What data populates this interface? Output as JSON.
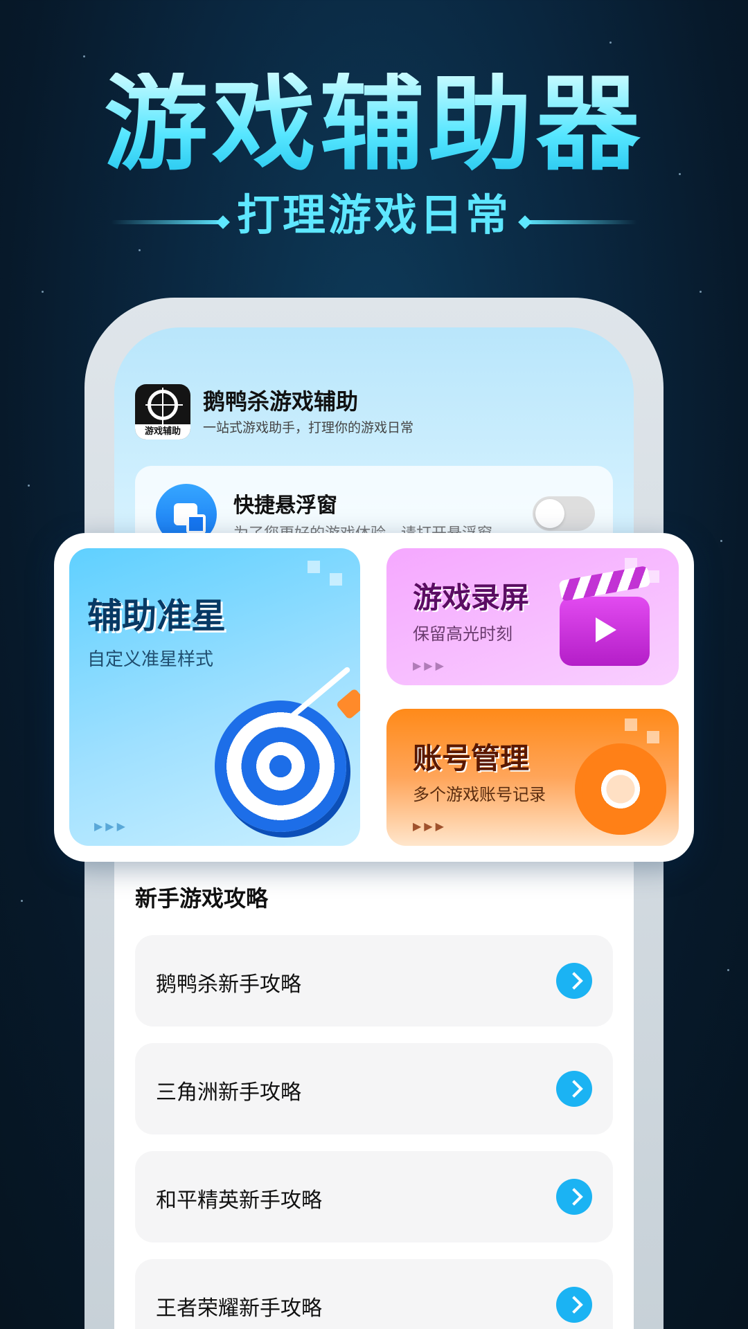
{
  "hero": {
    "title": "游戏辅助器",
    "subtitle": "打理游戏日常"
  },
  "app": {
    "icon_label": "游戏辅助",
    "name": "鹅鸭杀游戏辅助",
    "description": "一站式游戏助手，打理你的游戏日常"
  },
  "floating_window": {
    "title": "快捷悬浮窗",
    "description": "为了您更好的游戏体验，请打开悬浮窗",
    "enabled": false
  },
  "features": [
    {
      "title": "辅助准星",
      "subtitle": "自定义准星样式",
      "icon": "target-arrow-icon",
      "color": "#5fd0ff"
    },
    {
      "title": "游戏录屏",
      "subtitle": "保留高光时刻",
      "icon": "clapperboard-icon",
      "color": "#f5a8ff"
    },
    {
      "title": "账号管理",
      "subtitle": "多个游戏账号记录",
      "icon": "gear-icon",
      "color": "#ff8a19"
    }
  ],
  "guides": {
    "title": "新手游戏攻略",
    "items": [
      {
        "label": "鹅鸭杀新手攻略"
      },
      {
        "label": "三角洲新手攻略"
      },
      {
        "label": "和平精英新手攻略"
      },
      {
        "label": "王者荣耀新手攻略"
      }
    ]
  },
  "colors": {
    "accent_cyan": "#5ee7ff",
    "arrow_blue": "#1bb3f3",
    "background_dark": "#0a2740"
  }
}
